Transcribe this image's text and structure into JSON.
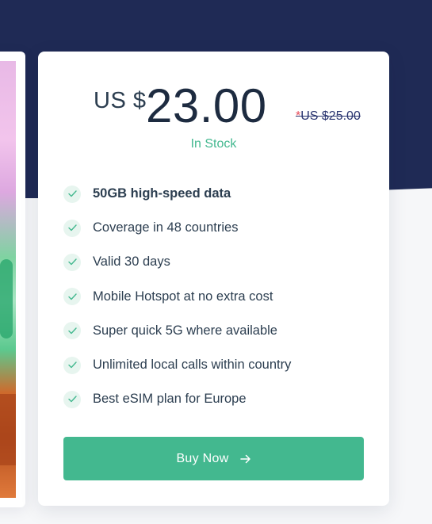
{
  "pricing": {
    "currency": "US $",
    "amount": "23.00",
    "old_price_star": "*",
    "old_price": "US $25.00",
    "stock_status": "In Stock"
  },
  "features": [
    {
      "text": "50GB high-speed data",
      "bold": true
    },
    {
      "text": "Coverage in 48 countries"
    },
    {
      "text": "Valid 30 days"
    },
    {
      "text": "Mobile Hotspot at no extra cost"
    },
    {
      "text": "Super quick 5G where available"
    },
    {
      "text": "Unlimited local calls within country"
    },
    {
      "text": "Best eSIM plan for Europe"
    }
  ],
  "buy_button": {
    "label": "Buy Now",
    "icon": "arrow-right-icon"
  },
  "colors": {
    "navy": "#1f2a55",
    "accent": "#43b88f",
    "strike_star": "#e74c5a"
  }
}
